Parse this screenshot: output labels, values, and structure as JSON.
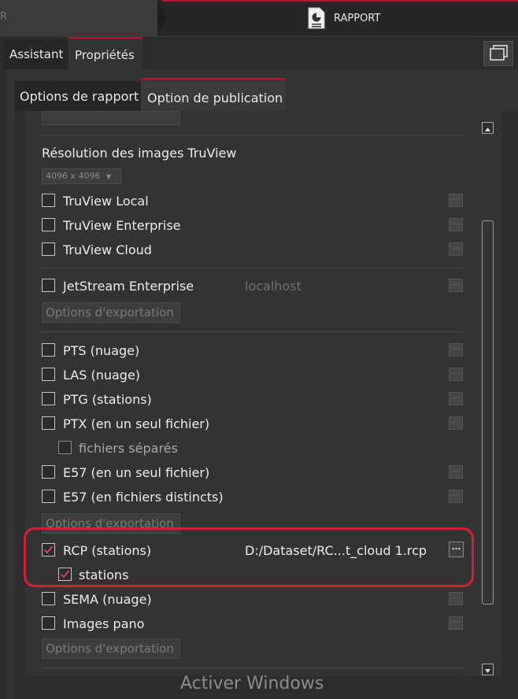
{
  "breadcrumb": {
    "previous_label": "R",
    "active_label": "RAPPORT",
    "active_icon": "report-icon"
  },
  "tabs": [
    {
      "label": "Assistant"
    },
    {
      "label": "Propriétés",
      "active": true
    }
  ],
  "subtabs": [
    {
      "label": "Options de rapport"
    },
    {
      "label": "Option de publication",
      "active": true
    }
  ],
  "truview": {
    "resolution_label": "Résolution des images TruView",
    "resolution_value": "4096 x 4096",
    "items": [
      {
        "label": "TruView Local",
        "checked": false
      },
      {
        "label": "TruView Enterprise",
        "checked": false
      },
      {
        "label": "TruView Cloud",
        "checked": false
      }
    ]
  },
  "jetstream": {
    "label": "JetStream Enterprise",
    "server": "localhost",
    "export_button": "Options d'exportation"
  },
  "formats": [
    {
      "label": "PTS (nuage)"
    },
    {
      "label": "LAS (nuage)"
    },
    {
      "label": "PTG (stations)"
    },
    {
      "label": "PTX (en un seul fichier)"
    },
    {
      "label": "fichiers séparés"
    },
    {
      "label": "E57 (en un seul fichier)"
    },
    {
      "label": "E57 (en fichiers distincts)"
    }
  ],
  "formats_export_button": "Options d'exportation",
  "rcp": {
    "label": "RCP (stations)",
    "path": "D:/Dataset/RC...t_cloud 1.rcp",
    "checked": true,
    "sub_label": "stations",
    "sub_checked": true,
    "highlight_color": "#d42030"
  },
  "others": [
    {
      "label": "SEMA (nuage)"
    },
    {
      "label": "Images pano"
    }
  ],
  "others_export_button": "Options d'exportation",
  "dots_label": "...",
  "watermark": "Activer Windows",
  "colors": {
    "accent": "#c8102e",
    "checkmark": "#e0405a"
  }
}
